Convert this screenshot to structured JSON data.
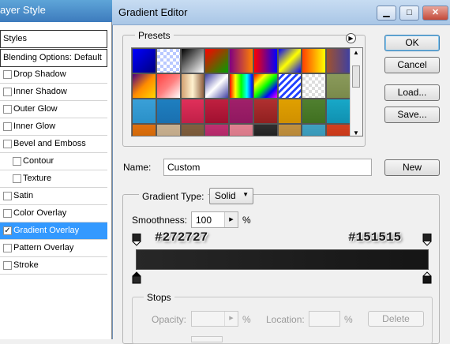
{
  "layer_style": {
    "title": "ayer Style",
    "styles_header": "Styles",
    "blending_options": "Blending Options: Default",
    "items": [
      {
        "label": "Drop Shadow",
        "checked": false,
        "indent": false
      },
      {
        "label": "Inner Shadow",
        "checked": false,
        "indent": false
      },
      {
        "label": "Outer Glow",
        "checked": false,
        "indent": false
      },
      {
        "label": "Inner Glow",
        "checked": false,
        "indent": false
      },
      {
        "label": "Bevel and Emboss",
        "checked": false,
        "indent": false
      },
      {
        "label": "Contour",
        "checked": false,
        "indent": true
      },
      {
        "label": "Texture",
        "checked": false,
        "indent": true
      },
      {
        "label": "Satin",
        "checked": false,
        "indent": false
      },
      {
        "label": "Color Overlay",
        "checked": false,
        "indent": false
      },
      {
        "label": "Gradient Overlay",
        "checked": true,
        "indent": false,
        "selected": true
      },
      {
        "label": "Pattern Overlay",
        "checked": false,
        "indent": false
      },
      {
        "label": "Stroke",
        "checked": false,
        "indent": false
      }
    ]
  },
  "dialog": {
    "title": "Gradient Editor",
    "presets_label": "Presets",
    "ok": "OK",
    "cancel": "Cancel",
    "load": "Load...",
    "save": "Save...",
    "name_label": "Name:",
    "name_value": "Custom",
    "new": "New",
    "gradient_type_label": "Gradient Type:",
    "gradient_type_value": "Solid",
    "smoothness_label": "Smoothness:",
    "smoothness_value": "100",
    "percent": "%",
    "left_color": "#272727",
    "right_color": "#151515",
    "stops_label": "Stops",
    "opacity_label": "Opacity:",
    "location_label": "Location:",
    "delete": "Delete"
  },
  "presets": [
    "linear-gradient(135deg,#0000ff,#000080)",
    "repeating-conic-gradient(#fff 0 25%,#b9c8ff 0 50%) 0 0/8px 8px",
    "linear-gradient(135deg,#000,#fff)",
    "linear-gradient(135deg,#ff0000,#00a000)",
    "linear-gradient(90deg,#800080,#ff8000)",
    "linear-gradient(90deg,#ff0000,#0000ff)",
    "linear-gradient(135deg,#0000ff,#ffff00,#0000ff)",
    "linear-gradient(90deg,#ff4000,#ffff00)",
    "linear-gradient(90deg,#a0522d,#4040a0)",
    "linear-gradient(135deg,#4b0082,#ff8c00,#ffd700)",
    "linear-gradient(135deg,#ff4040,#ff8080,#fff)",
    "linear-gradient(90deg,#d2a070,#fff2d0,#906040)",
    "linear-gradient(135deg,#4040a0,#fff,#4040a0)",
    "linear-gradient(90deg,#ff0000,#ffff00,#00ff00,#00ffff,#0000ff)",
    "linear-gradient(135deg,#ff0000,#ffff00,#00ff00,#0000ff,#ff00ff)",
    "repeating-linear-gradient(135deg,#fff 0 3px,#2040ff 3px 6px)",
    "repeating-conic-gradient(#ddd 0 25%,#fff 0 50%) 0 0/8px 8px",
    "linear-gradient(#8a9a5b,#7a8a4b)",
    "linear-gradient(#3aa0d8,#2a90c8)",
    "linear-gradient(#1e7fc0,#1a70b0)",
    "linear-gradient(#e0305a,#c02048)",
    "linear-gradient(#c02040,#a01030)",
    "linear-gradient(#a0206a,#901860)",
    "linear-gradient(#b03030,#902020)",
    "linear-gradient(#e0a000,#d09000)",
    "linear-gradient(#508030,#407020)",
    "linear-gradient(#18a8c8,#1090b0)",
    "linear-gradient(#e07010,#c06000)",
    "linear-gradient(#c8b090,#b8a080)",
    "linear-gradient(#806040,#705030)",
    "linear-gradient(#c03070,#a02060)",
    "linear-gradient(#e08090,#d07080)",
    "linear-gradient(#303030,#101010)",
    "linear-gradient(#c09040,#b08030)",
    "linear-gradient(#40a0c0,#3090b0)",
    "linear-gradient(#d04020,#c03010)"
  ]
}
